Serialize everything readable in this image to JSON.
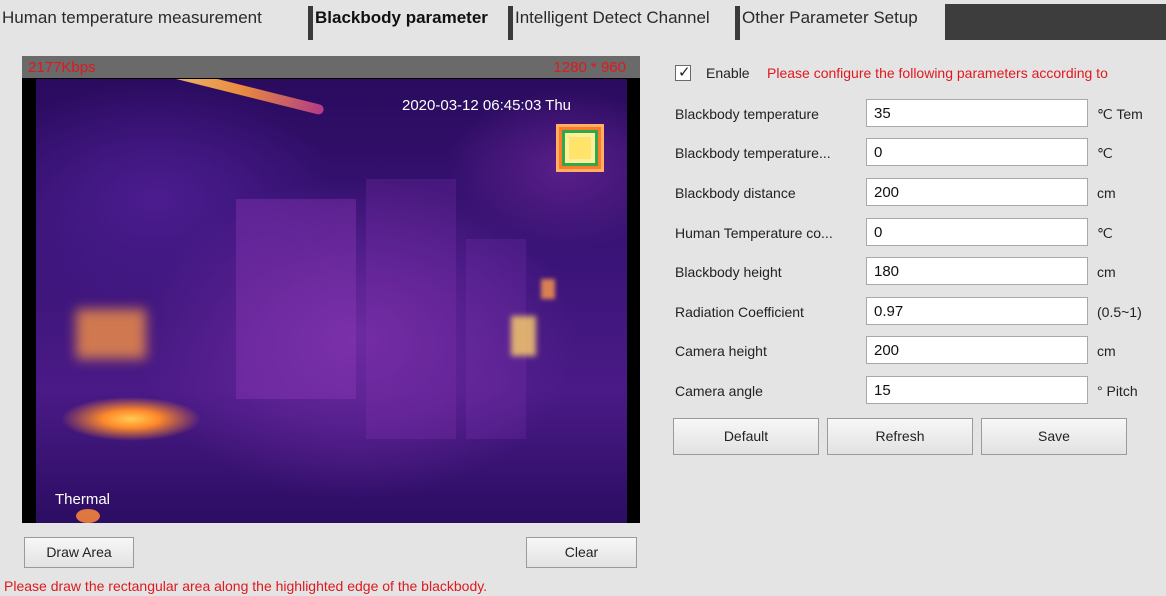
{
  "tabs": [
    {
      "label": "Human temperature measurement"
    },
    {
      "label": "Blackbody parameter"
    },
    {
      "label": "Intelligent Detect Channel"
    },
    {
      "label": "Other Parameter Setup"
    }
  ],
  "video": {
    "bitrate": "2177Kbps",
    "resolution": "1280 * 960",
    "timestamp": "2020-03-12 06:45:03 Thu",
    "channel_label": "Thermal"
  },
  "draw_area_button": "Draw Area",
  "clear_button": "Clear",
  "hint": "Please draw the rectangular area along the highlighted edge of the blackbody.",
  "form": {
    "enable_checked": true,
    "enable_label": "Enable",
    "enable_note": "Please configure the following parameters according to",
    "fields": [
      {
        "label": "Blackbody temperature",
        "value": "35",
        "unit": "℃   Tem"
      },
      {
        "label": "Blackbody temperature...",
        "value": "0",
        "unit": "℃"
      },
      {
        "label": "Blackbody distance",
        "value": "200",
        "unit": "cm"
      },
      {
        "label": "Human Temperature co...",
        "value": "0",
        "unit": "℃"
      },
      {
        "label": "Blackbody height",
        "value": "180",
        "unit": "cm"
      },
      {
        "label": "Radiation Coefficient",
        "value": "0.97",
        "unit": "(0.5~1)"
      },
      {
        "label": "Camera height",
        "value": "200",
        "unit": "cm"
      },
      {
        "label": "Camera angle",
        "value": "15",
        "unit": "°   Pitch"
      }
    ],
    "buttons": {
      "default": "Default",
      "refresh": "Refresh",
      "save": "Save"
    }
  },
  "colors": {
    "accent_red": "#e0181f",
    "tab_separator": "#3a3a3a"
  }
}
